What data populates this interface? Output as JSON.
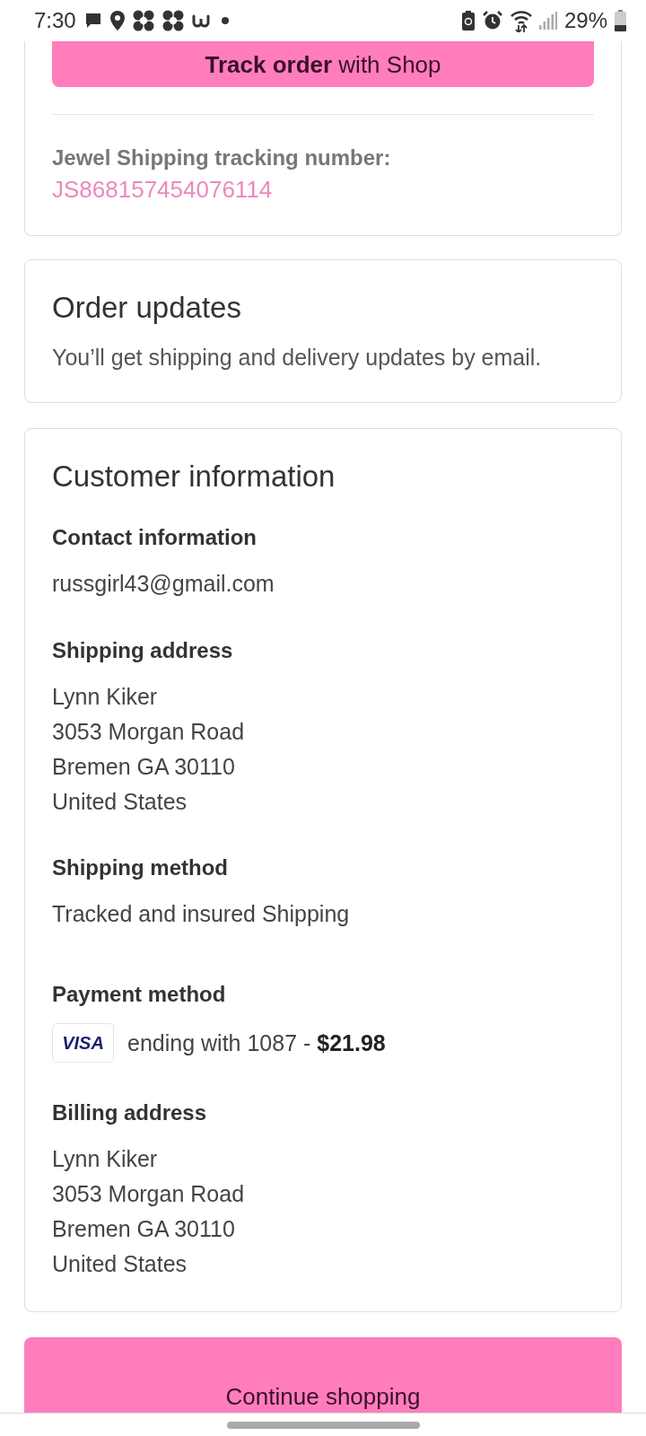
{
  "status_bar": {
    "time": "7:30",
    "battery": "29%"
  },
  "tracking": {
    "button": "**Track order** with Shop",
    "label": "Jewel Shipping tracking number:",
    "number": "JS868157454076114"
  },
  "order_updates": {
    "title": "Order updates",
    "text": "You’ll get shipping and delivery updates by email."
  },
  "customer_information": {
    "title": "Customer information",
    "sections": [
      {
        "kind": "lines",
        "heading": "Contact information",
        "lines": [
          "russgirl43@gmail.com"
        ]
      },
      {
        "kind": "lines",
        "heading": "Shipping address",
        "lines": [
          "Lynn Kiker",
          "3053 Morgan Road",
          "Bremen GA 30110",
          "United States"
        ]
      },
      {
        "kind": "lines",
        "heading": "Shipping method",
        "lines": [
          "Tracked and insured Shipping"
        ]
      },
      {
        "kind": "payment",
        "heading": "Payment method",
        "card_brand": "VISA",
        "text": "ending with 1087 - **$21.98**"
      },
      {
        "kind": "lines",
        "heading": "Billing address",
        "lines": [
          "Lynn Kiker",
          "3053 Morgan Road",
          "Bremen GA 30110",
          "United States"
        ]
      }
    ]
  },
  "continue_button": "Continue shopping"
}
